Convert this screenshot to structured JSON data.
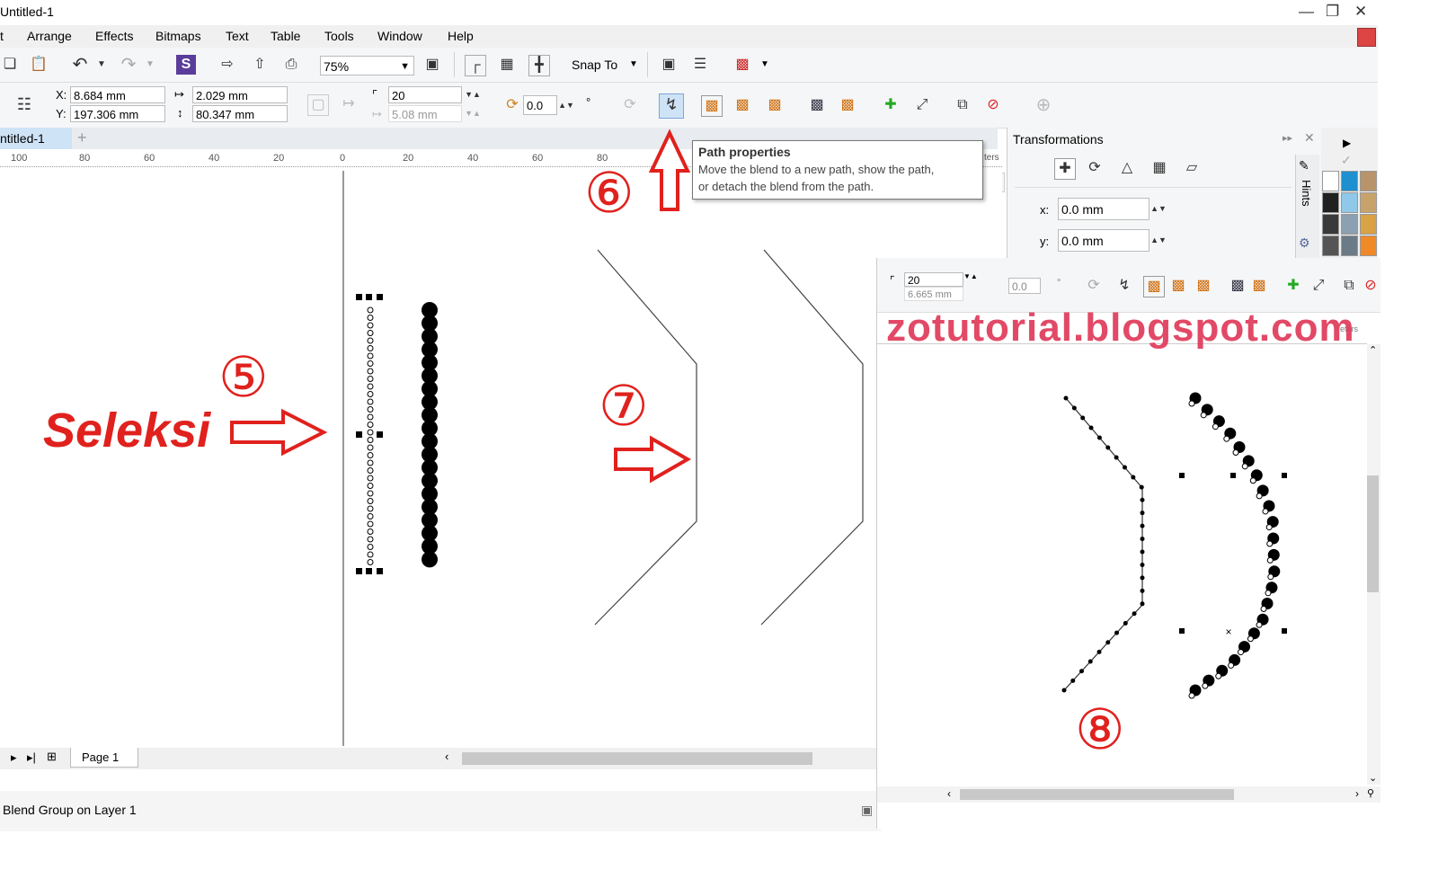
{
  "window": {
    "title": "Untitled-1"
  },
  "menu": [
    "t",
    "Arrange",
    "Effects",
    "Bitmaps",
    "Text",
    "Table",
    "Tools",
    "Window",
    "Help"
  ],
  "toolbar": {
    "zoom": "75%",
    "snap_to": "Snap To"
  },
  "property_bar": {
    "x_label": "X:",
    "x_value": "8.684 mm",
    "y_label": "Y:",
    "y_value": "197.306 mm",
    "w_value": "2.029 mm",
    "h_value": "80.347 mm",
    "steps_value": "20",
    "spacing_value": "5.08 mm",
    "angle_value": "0.0",
    "degree": "°"
  },
  "document_tab": "ntitled-1",
  "ruler": {
    "labels": [
      "100",
      "80",
      "60",
      "40",
      "20",
      "0",
      "20",
      "40",
      "60",
      "80"
    ],
    "unit_fragment": "ters"
  },
  "tooltip": {
    "title": "Path properties",
    "line1": "Move the blend to a new path, show the path,",
    "line2": "or detach the blend from the path."
  },
  "transformations": {
    "title": "Transformations",
    "x_label": "x:",
    "x_value": "0.0 mm",
    "y_label": "y:",
    "y_value": "0.0 mm",
    "hints": "Hints"
  },
  "annotations": {
    "seleksi": "Seleksi",
    "step5": "⑤",
    "step6": "⑥",
    "step7": "⑦",
    "step8": "⑧",
    "watermark": "zotutorial.blogspot.com"
  },
  "page_tab": "Page 1",
  "status": "Blend Group on Layer 1",
  "inset": {
    "steps_value": "20",
    "spacing_value": "6.665 mm",
    "angle_value": "0.0",
    "degree": "°",
    "unit_fragment": "eters"
  },
  "palette_colors": [
    "#ffffff",
    "#1e8fcf",
    "#b8946a",
    "#202020",
    "#8fc8e8",
    "#c7a36b",
    "#3a3a3a",
    "#8ba0b0",
    "#d8a245",
    "#555555",
    "#6a7a86",
    "#f08a28"
  ],
  "colors": {
    "accent_red": "#e0211d",
    "highlight": "#cfe3f7"
  }
}
